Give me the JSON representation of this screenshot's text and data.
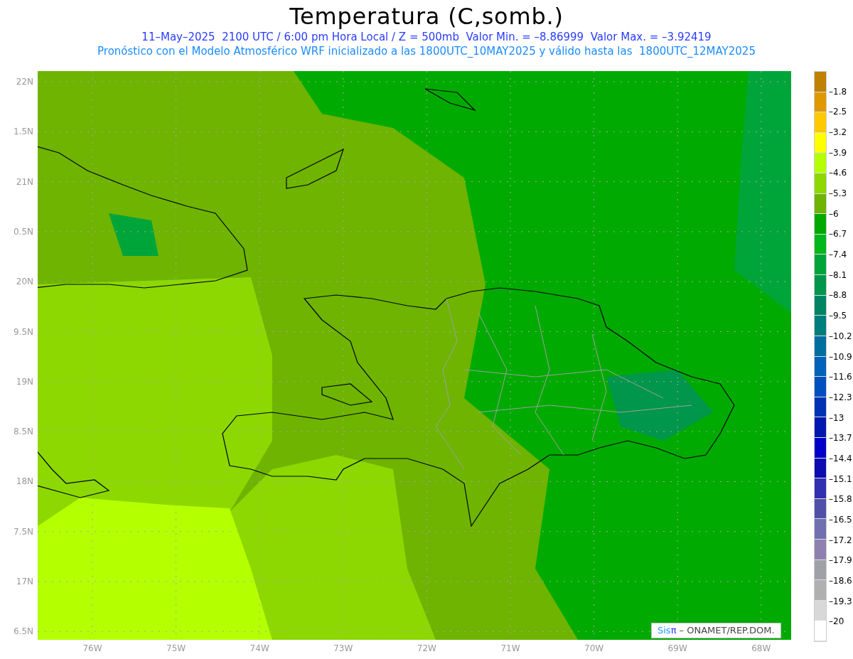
{
  "title": "Temperatura (C,somb.)",
  "info_line": "11–May–2025  2100 UTC / 6:00 pm Hora Local / Z = 500mb  Valor Min. = –8.86999  Valor Max. = –3.92419",
  "model_line": "Pronóstico con el Modelo Atmosférico WRF inicializado a las 1800UTC_10MAY2025 y válido hasta las  1800UTC_12MAY2025",
  "lat_labels": [
    "22N",
    "1.5N",
    "21N",
    "0.5N",
    "20N",
    "9.5N",
    "19N",
    "8.5N",
    "18N",
    "7.5N",
    "17N",
    "6.5N"
  ],
  "lon_labels": [
    "76W",
    "75W",
    "74W",
    "73W",
    "72W",
    "71W",
    "70W",
    "69W",
    "68W"
  ],
  "colorbar": {
    "boxes": [
      {
        "color": "#c08000"
      },
      {
        "color": "#e09800"
      },
      {
        "color": "#ffc800"
      },
      {
        "color": "#ffff00"
      },
      {
        "color": "#b4ff00"
      },
      {
        "color": "#8cd800"
      },
      {
        "color": "#6eb400"
      },
      {
        "color": "#00aa00"
      },
      {
        "color": "#00b81a"
      },
      {
        "color": "#00a53a"
      },
      {
        "color": "#00964b"
      },
      {
        "color": "#008464"
      },
      {
        "color": "#007d7d"
      },
      {
        "color": "#006fa0"
      },
      {
        "color": "#0062b8"
      },
      {
        "color": "#004fc0"
      },
      {
        "color": "#0033b3"
      },
      {
        "color": "#0018b0"
      },
      {
        "color": "#0000c8"
      },
      {
        "color": "#0c0cb0"
      },
      {
        "color": "#3030b0"
      },
      {
        "color": "#5050a8"
      },
      {
        "color": "#7070b0"
      },
      {
        "color": "#9080b0"
      },
      {
        "color": "#a0a0a8"
      },
      {
        "color": "#b0b0b0"
      },
      {
        "color": "#d8d8d8"
      },
      {
        "color": "#ffffff"
      }
    ],
    "labels": [
      "–1.8",
      "–2.5",
      "–3.2",
      "–3.9",
      "–4.6",
      "–5.3",
      "–6",
      "–6.7",
      "–7.4",
      "–8.1",
      "–8.8",
      "–9.5",
      "–10.2",
      "–10.9",
      "–11.6",
      "–12.3",
      "–13",
      "–13.7",
      "–14.4",
      "–15.1",
      "–15.8",
      "–16.5",
      "–17.2",
      "–17.9",
      "–18.6",
      "–19.3",
      "–20"
    ]
  },
  "credit": {
    "brand": "Sis",
    "brand_symbol": "π",
    "text": "– ONAMET/REP.DOM."
  }
}
